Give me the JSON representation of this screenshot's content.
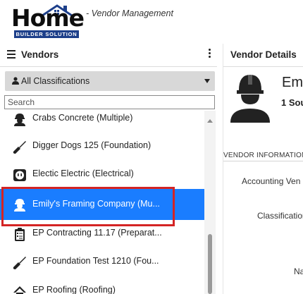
{
  "header": {
    "logo_text": "Home",
    "logo_subtext": "BUILDER SOLUTION",
    "app_subtitle": "- Vendor Management"
  },
  "left_panel": {
    "title": "Vendors",
    "classification_selected": "All Classifications",
    "search_placeholder": "Search",
    "items": [
      {
        "label": "Crabs Concrete (Multiple)",
        "icon": "worker-hardhat-icon",
        "selected": false
      },
      {
        "label": "Digger Dogs 125 (Foundation)",
        "icon": "trowel-icon",
        "selected": false
      },
      {
        "label": "Electic Electric (Electrical)",
        "icon": "electrical-outlet-icon",
        "selected": false
      },
      {
        "label": "Emily's Framing Company (Mu...",
        "icon": "worker-hardhat-icon",
        "selected": true
      },
      {
        "label": "EP Contracting 11.17 (Preparat...",
        "icon": "clipboard-checklist-icon",
        "selected": false
      },
      {
        "label": "EP Foundation Test 1210 (Fou...",
        "icon": "trowel-icon",
        "selected": false
      },
      {
        "label": "EP Roofing (Roofing)",
        "icon": "roof-icon",
        "selected": false
      }
    ]
  },
  "right_panel": {
    "title": "Vendor Details",
    "vendor_name_partial": "Emi",
    "vendor_address_partial": "1 Sou",
    "section_label": "VENDOR INFORMATION",
    "field_accounting": "Accounting Ven",
    "field_classification": "Classification",
    "field_name_partial": "Na"
  },
  "colors": {
    "selected_row": "#1a7dff",
    "highlight_border": "#d42424",
    "logo_blue": "#1d3f8a"
  }
}
